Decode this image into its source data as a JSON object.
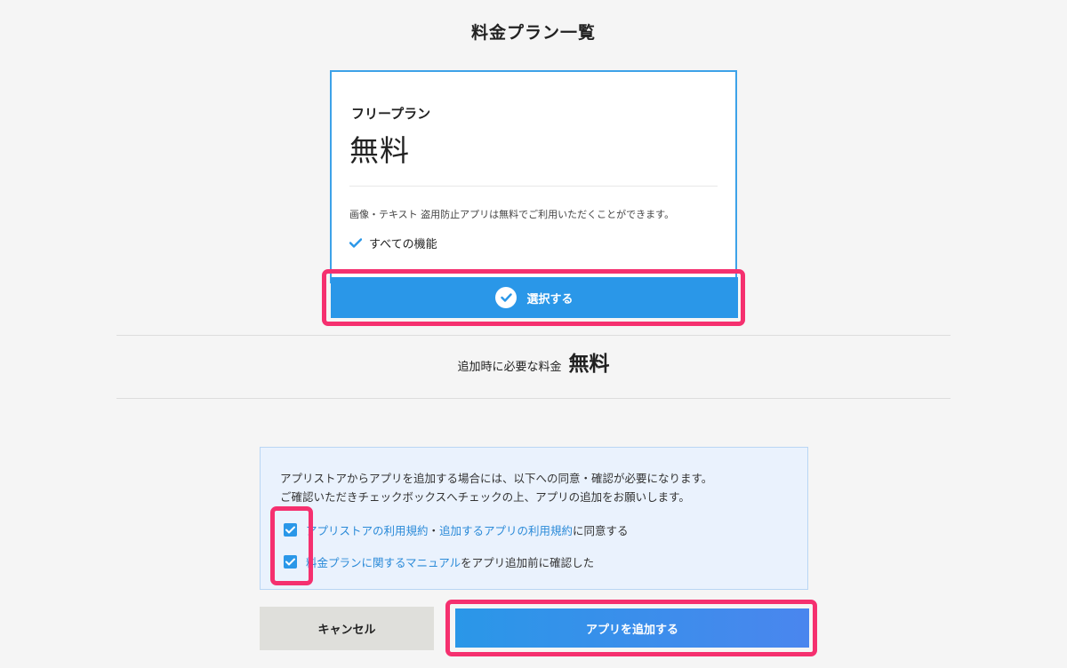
{
  "page": {
    "title": "料金プラン一覧"
  },
  "plan": {
    "name": "フリープラン",
    "price": "無料",
    "description": "画像・テキスト 盗用防止アプリは無料でご利用いただくことができます。",
    "feature": "すべての機能",
    "select_label": "選択する"
  },
  "fee": {
    "label": "追加時に必要な料金",
    "value": "無料"
  },
  "consent": {
    "line1": "アプリストアからアプリを追加する場合には、以下への同意・確認が必要になります。",
    "line2": "ご確認いただきチェックボックスへチェックの上、アプリの追加をお願いします。",
    "item1": {
      "link1": "アプリストアの利用規約",
      "sep": "・",
      "link2": "追加するアプリの利用規約",
      "suffix": "に同意する",
      "checked": true
    },
    "item2": {
      "link": "料金プランに関するマニュアル",
      "suffix": "をアプリ追加前に確認した",
      "checked": true
    }
  },
  "buttons": {
    "cancel": "キャンセル",
    "add": "アプリを追加する"
  },
  "colors": {
    "accent": "#2a97e8",
    "highlight": "#f5306f",
    "link": "#2a8ad8"
  }
}
